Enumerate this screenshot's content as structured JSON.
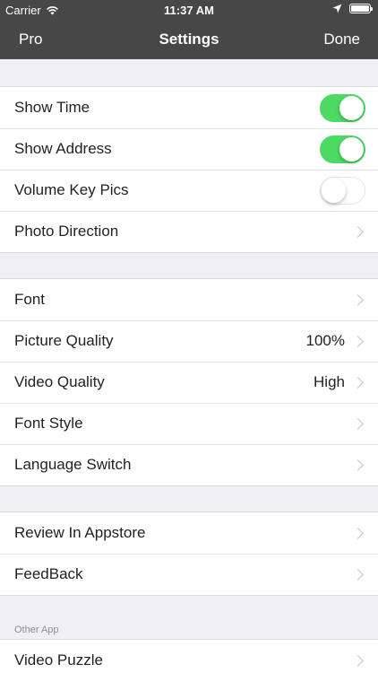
{
  "status_bar": {
    "carrier": "Carrier",
    "time": "11:37 AM"
  },
  "nav": {
    "left_label": "Pro",
    "title": "Settings",
    "right_label": "Done"
  },
  "groups": [
    {
      "rows": [
        {
          "label": "Show Time",
          "toggle": true
        },
        {
          "label": "Show Address",
          "toggle": true
        },
        {
          "label": "Volume Key Pics",
          "toggle": false
        },
        {
          "label": "Photo Direction"
        }
      ]
    },
    {
      "rows": [
        {
          "label": "Font"
        },
        {
          "label": "Picture Quality",
          "value": "100%"
        },
        {
          "label": "Video Quality",
          "value": "High"
        },
        {
          "label": "Font Style"
        },
        {
          "label": "Language Switch"
        }
      ]
    },
    {
      "rows": [
        {
          "label": "Review In Appstore"
        },
        {
          "label": "FeedBack"
        }
      ]
    },
    {
      "header": "Other App",
      "rows": [
        {
          "label": "Video Puzzle"
        }
      ]
    }
  ],
  "colors": {
    "bar": "#474747",
    "toggle_on": "#4cd964",
    "background": "#efeff4"
  }
}
